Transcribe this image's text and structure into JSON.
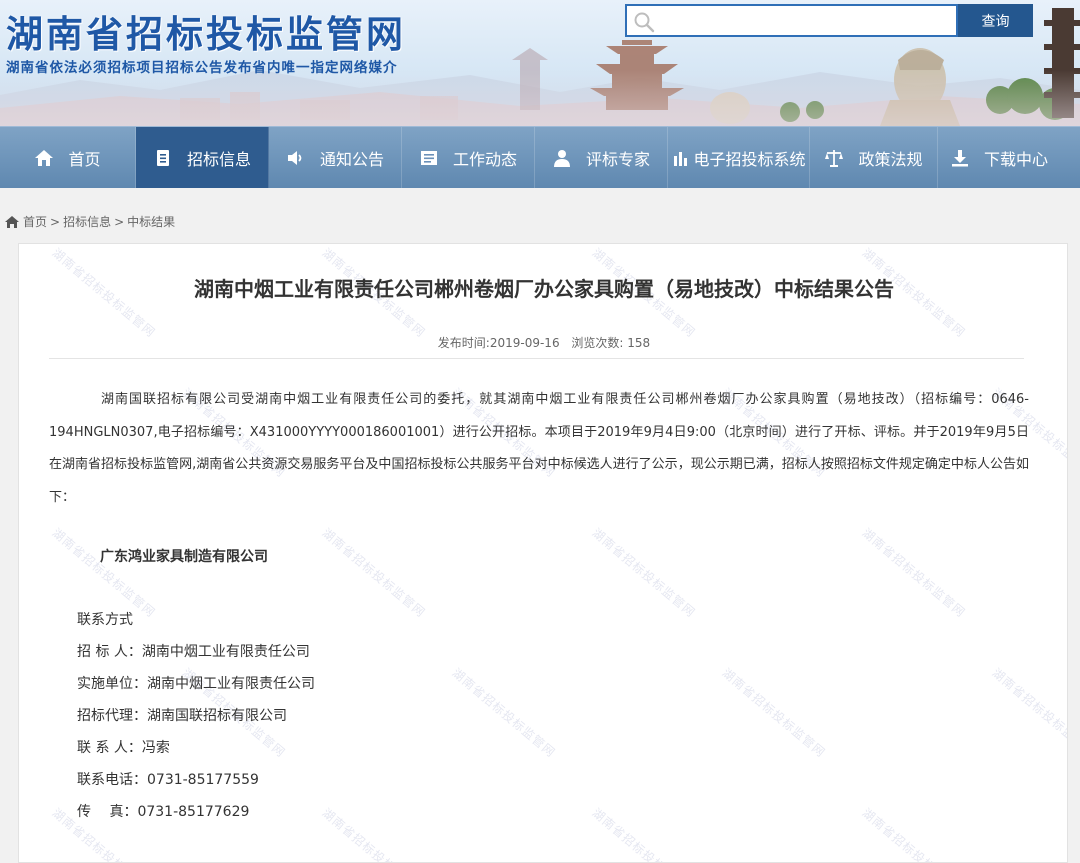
{
  "header": {
    "site_title": "湖南省招标投标监管网",
    "site_subtitle": "湖南省依法必须招标项目招标公告发布省内唯一指定网络媒介",
    "search": {
      "placeholder": "",
      "value": "",
      "button_label": "查询"
    }
  },
  "nav": {
    "items": [
      {
        "label": "首页",
        "icon": "home-icon"
      },
      {
        "label": "招标信息",
        "icon": "document-icon",
        "active": true
      },
      {
        "label": "通知公告",
        "icon": "speaker-icon"
      },
      {
        "label": "工作动态",
        "icon": "list-icon"
      },
      {
        "label": "评标专家",
        "icon": "expert-icon"
      },
      {
        "label": "电子招投标系统",
        "icon": "bar-chart-icon"
      },
      {
        "label": "政策法规",
        "icon": "scales-icon"
      },
      {
        "label": "下载中心",
        "icon": "download-icon"
      }
    ]
  },
  "breadcrumb": {
    "home": "首页",
    "sep": ">",
    "level1": "招标信息",
    "level2": "中标结果"
  },
  "article": {
    "title": "湖南中烟工业有限责任公司郴州卷烟厂办公家具购置（易地技改）中标结果公告",
    "publish_time_label": "发布时间:2019-09-16",
    "views_label": "浏览次数: 158",
    "body": "湖南国联招标有限公司受湖南中烟工业有限责任公司的委托，就其湖南中烟工业有限责任公司郴州卷烟厂办公家具购置（易地技改）（招标编号：0646-194HNGLN0307,电子招标编号：X431000YYYY000186001001）进行公开招标。本项目于2019年9月4日9:00（北京时间）进行了开标、评标。并于2019年9月5日在湖南省招标投标监管网,湖南省公共资源交易服务平台及中国招标投标公共服务平台对中标候选人进行了公示，现公示期已满，招标人按照招标文件规定确定中标人公告如下：",
    "winner": "广东鸿业家具制造有限公司",
    "contact": {
      "heading": "联系方式",
      "tenderer": "招 标 人：湖南中烟工业有限责任公司",
      "implementer": "实施单位：湖南中烟工业有限责任公司",
      "agent": "招标代理：湖南国联招标有限公司",
      "person": "联 系 人：冯索",
      "phone": "联系电话：0731-85177559",
      "fax": "传　 真：0731-85177629"
    }
  },
  "watermark_text": "湖南省招标投标监管网",
  "colors": {
    "brand_blue": "#1f58a6",
    "nav_bg": "#6a90b8",
    "nav_active": "#2f5c8f",
    "search_button": "#24578f"
  }
}
